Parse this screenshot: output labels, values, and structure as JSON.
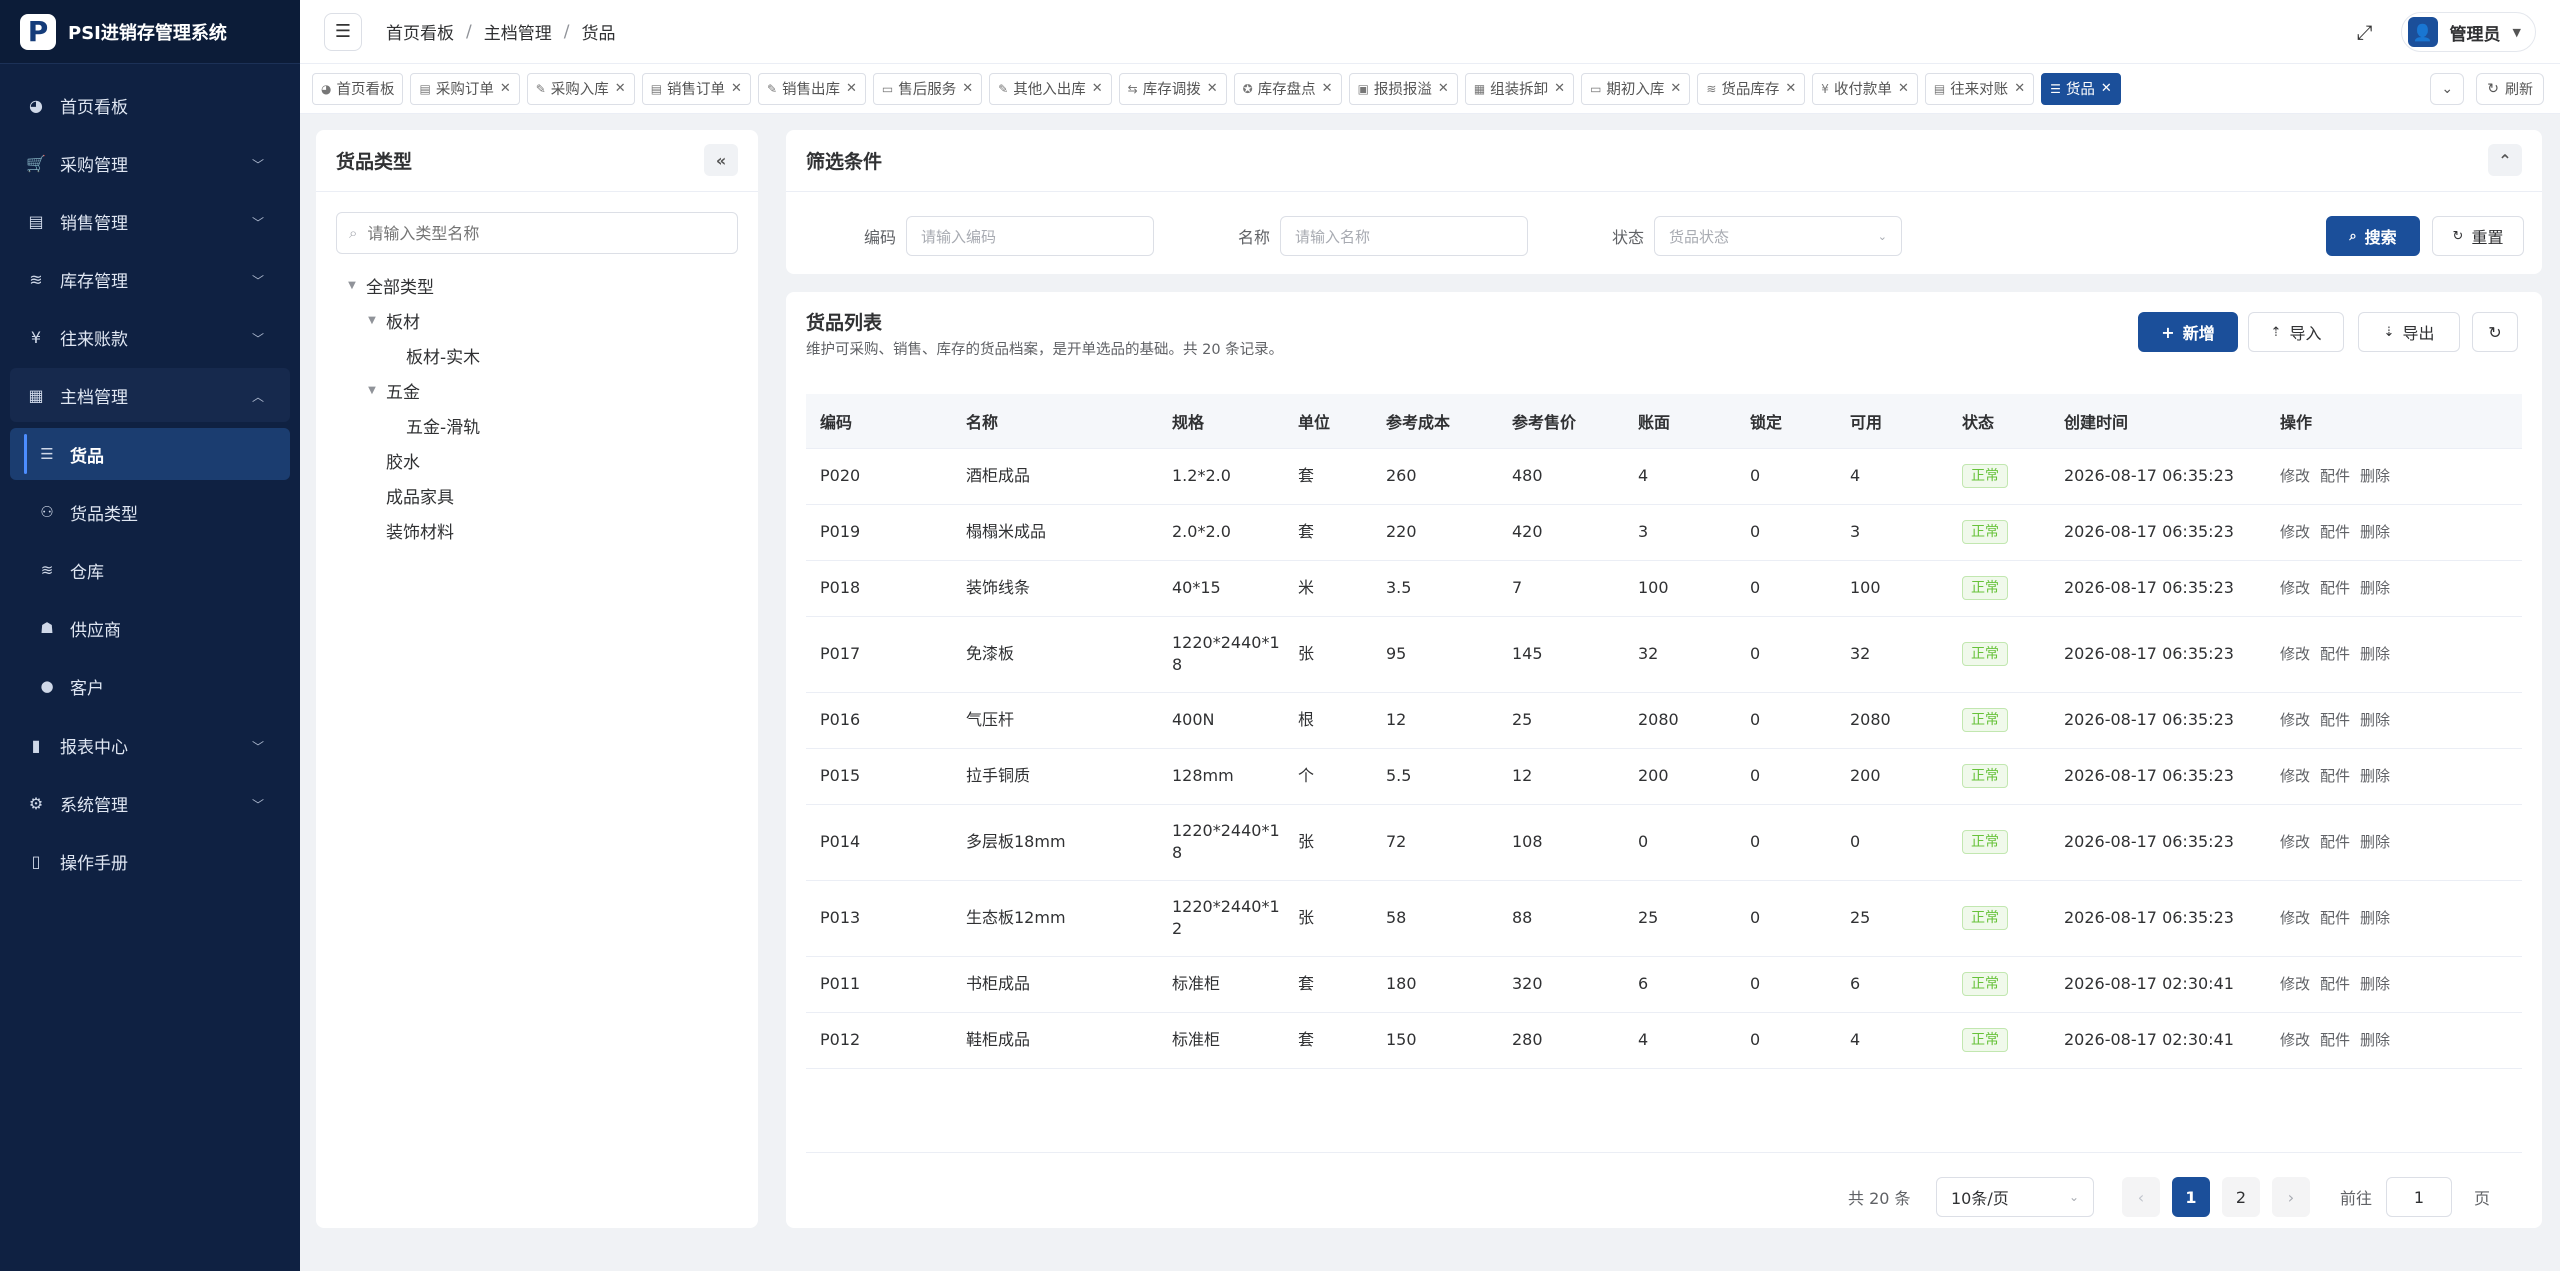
{
  "brand": {
    "logo": "P",
    "title": "PSI进销存管理系统"
  },
  "menu": [
    {
      "icon": "dashboard-icon",
      "glyph": "◕",
      "label": "首页看板",
      "chevron": false
    },
    {
      "icon": "cart-icon",
      "glyph": "🛒",
      "label": "采购管理",
      "chevron": true
    },
    {
      "icon": "sales-icon",
      "glyph": "▤",
      "label": "销售管理",
      "chevron": true
    },
    {
      "icon": "stack-icon",
      "glyph": "≋",
      "label": "库存管理",
      "chevron": true
    },
    {
      "icon": "yen-icon",
      "glyph": "¥",
      "label": "往来账款",
      "chevron": true
    },
    {
      "icon": "master-icon",
      "glyph": "▦",
      "label": "主档管理",
      "chevron": true,
      "open": true
    }
  ],
  "submenu": [
    {
      "icon": "list-icon",
      "glyph": "☰",
      "label": "货品",
      "active": true
    },
    {
      "icon": "hierarchy-icon",
      "glyph": "⚇",
      "label": "货品类型"
    },
    {
      "icon": "warehouse-icon",
      "glyph": "≋",
      "label": "仓库"
    },
    {
      "icon": "supplier-icon",
      "glyph": "☗",
      "label": "供应商"
    },
    {
      "icon": "customer-icon",
      "glyph": "●",
      "label": "客户"
    }
  ],
  "menu_bottom": [
    {
      "icon": "chart-icon",
      "glyph": "▮",
      "label": "报表中心",
      "chevron": true
    },
    {
      "icon": "gear-icon",
      "glyph": "⚙",
      "label": "系统管理",
      "chevron": true
    },
    {
      "icon": "book-icon",
      "glyph": "▯",
      "label": "操作手册",
      "chevron": false
    }
  ],
  "breadcrumb": [
    "首页看板",
    "主档管理",
    "货品"
  ],
  "user": {
    "name": "管理员"
  },
  "tabs": [
    {
      "glyph": "◕",
      "label": "首页看板",
      "closable": false
    },
    {
      "glyph": "▤",
      "label": "采购订单",
      "closable": true
    },
    {
      "glyph": "✎",
      "label": "采购入库",
      "closable": true
    },
    {
      "glyph": "▤",
      "label": "销售订单",
      "closable": true
    },
    {
      "glyph": "✎",
      "label": "销售出库",
      "closable": true
    },
    {
      "glyph": "▭",
      "label": "售后服务",
      "closable": true
    },
    {
      "glyph": "✎",
      "label": "其他入出库",
      "closable": true
    },
    {
      "glyph": "⇆",
      "label": "库存调拨",
      "closable": true
    },
    {
      "glyph": "✪",
      "label": "库存盘点",
      "closable": true
    },
    {
      "glyph": "▣",
      "label": "报损报溢",
      "closable": true
    },
    {
      "glyph": "▦",
      "label": "组装拆卸",
      "closable": true
    },
    {
      "glyph": "▭",
      "label": "期初入库",
      "closable": true
    },
    {
      "glyph": "≋",
      "label": "货品库存",
      "closable": true
    },
    {
      "glyph": "¥",
      "label": "收付款单",
      "closable": true
    },
    {
      "glyph": "▤",
      "label": "往来对账",
      "closable": true
    },
    {
      "glyph": "☰",
      "label": "货品",
      "closable": true,
      "active": true
    }
  ],
  "tabs_refresh": "刷新",
  "left_panel": {
    "title": "货品类型",
    "search_placeholder": "请输入类型名称",
    "tree": [
      {
        "label": "全部类型",
        "level": 0,
        "caret": true
      },
      {
        "label": "板材",
        "level": 1,
        "caret": true
      },
      {
        "label": "板材-实木",
        "level": 2,
        "caret": false
      },
      {
        "label": "五金",
        "level": 1,
        "caret": true
      },
      {
        "label": "五金-滑轨",
        "level": 2,
        "caret": false
      },
      {
        "label": "胶水",
        "level": 1,
        "caret": false
      },
      {
        "label": "成品家具",
        "level": 1,
        "caret": false
      },
      {
        "label": "装饰材料",
        "level": 1,
        "caret": false
      }
    ]
  },
  "filter": {
    "title": "筛选条件",
    "code_label": "编码",
    "code_placeholder": "请输入编码",
    "name_label": "名称",
    "name_placeholder": "请输入名称",
    "status_label": "状态",
    "status_placeholder": "货品状态",
    "search_btn": "搜索",
    "reset_btn": "重置"
  },
  "list": {
    "title": "货品列表",
    "subtitle": "维护可采购、销售、库存的货品档案，是开单选品的基础。共 20 条记录。",
    "add_btn": "新增",
    "import_btn": "导入",
    "export_btn": "导出",
    "columns": [
      "编码",
      "名称",
      "规格",
      "单位",
      "参考成本",
      "参考售价",
      "账面",
      "锁定",
      "可用",
      "状态",
      "创建时间",
      "操作"
    ],
    "ops": [
      "修改",
      "配件",
      "删除"
    ],
    "rows": [
      {
        "code": "P020",
        "name": "酒柜成品",
        "spec": "1.2*2.0",
        "unit": "套",
        "cost": "260",
        "price": "480",
        "book": "4",
        "locked": "0",
        "avail": "4",
        "status": "正常",
        "created": "2026-08-17 06:35:23",
        "tall": false
      },
      {
        "code": "P019",
        "name": "榻榻米成品",
        "spec": "2.0*2.0",
        "unit": "套",
        "cost": "220",
        "price": "420",
        "book": "3",
        "locked": "0",
        "avail": "3",
        "status": "正常",
        "created": "2026-08-17 06:35:23",
        "tall": false
      },
      {
        "code": "P018",
        "name": "装饰线条",
        "spec": "40*15",
        "unit": "米",
        "cost": "3.5",
        "price": "7",
        "book": "100",
        "locked": "0",
        "avail": "100",
        "status": "正常",
        "created": "2026-08-17 06:35:23",
        "tall": false
      },
      {
        "code": "P017",
        "name": "免漆板",
        "spec": "1220*2440*18",
        "unit": "张",
        "cost": "95",
        "price": "145",
        "book": "32",
        "locked": "0",
        "avail": "32",
        "status": "正常",
        "created": "2026-08-17 06:35:23",
        "tall": true
      },
      {
        "code": "P016",
        "name": "气压杆",
        "spec": "400N",
        "unit": "根",
        "cost": "12",
        "price": "25",
        "book": "2080",
        "locked": "0",
        "avail": "2080",
        "status": "正常",
        "created": "2026-08-17 06:35:23",
        "tall": false
      },
      {
        "code": "P015",
        "name": "拉手铜质",
        "spec": "128mm",
        "unit": "个",
        "cost": "5.5",
        "price": "12",
        "book": "200",
        "locked": "0",
        "avail": "200",
        "status": "正常",
        "created": "2026-08-17 06:35:23",
        "tall": false
      },
      {
        "code": "P014",
        "name": "多层板18mm",
        "spec": "1220*2440*18",
        "unit": "张",
        "cost": "72",
        "price": "108",
        "book": "0",
        "locked": "0",
        "avail": "0",
        "status": "正常",
        "created": "2026-08-17 06:35:23",
        "tall": true
      },
      {
        "code": "P013",
        "name": "生态板12mm",
        "spec": "1220*2440*12",
        "unit": "张",
        "cost": "58",
        "price": "88",
        "book": "25",
        "locked": "0",
        "avail": "25",
        "status": "正常",
        "created": "2026-08-17 06:35:23",
        "tall": true
      },
      {
        "code": "P011",
        "name": "书柜成品",
        "spec": "标准柜",
        "unit": "套",
        "cost": "180",
        "price": "320",
        "book": "6",
        "locked": "0",
        "avail": "6",
        "status": "正常",
        "created": "2026-08-17 02:30:41",
        "tall": false
      },
      {
        "code": "P012",
        "name": "鞋柜成品",
        "spec": "标准柜",
        "unit": "套",
        "cost": "150",
        "price": "280",
        "book": "4",
        "locked": "0",
        "avail": "4",
        "status": "正常",
        "created": "2026-08-17 02:30:41",
        "tall": false
      }
    ]
  },
  "pager": {
    "total": "共 20 条",
    "page_size": "10条/页",
    "pages": [
      "1",
      "2"
    ],
    "goto_label": "前往",
    "goto_value": "1",
    "page_unit": "页"
  },
  "colors": {
    "primary": "#1b4f9a",
    "sidebar": "#0f2142",
    "success": "#67c23a"
  }
}
